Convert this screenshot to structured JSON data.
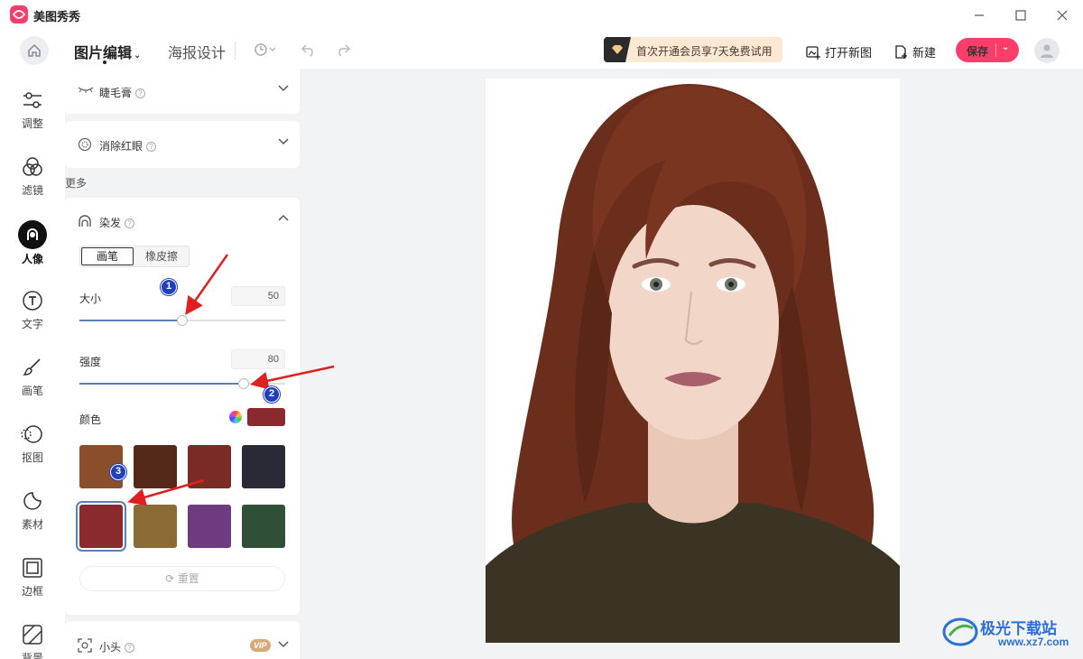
{
  "app": {
    "name": "美图秀秀"
  },
  "toolbar": {
    "tab_edit": "图片编辑",
    "tab_poster": "海报设计",
    "vip_banner": "首次开通会员享7天免费试用",
    "open_image": "打开新图",
    "new": "新建",
    "save": "保存"
  },
  "rail": {
    "items": [
      {
        "label": "调整",
        "icon": "sliders-icon"
      },
      {
        "label": "滤镜",
        "icon": "filter-icon"
      },
      {
        "label": "人像",
        "icon": "portrait-icon"
      },
      {
        "label": "文字",
        "icon": "text-icon"
      },
      {
        "label": "画笔",
        "icon": "brush-icon"
      },
      {
        "label": "抠图",
        "icon": "cutout-icon"
      },
      {
        "label": "素材",
        "icon": "sticker-icon"
      },
      {
        "label": "边框",
        "icon": "frame-icon"
      },
      {
        "label": "背景",
        "icon": "background-icon"
      }
    ]
  },
  "panel": {
    "mascara": {
      "title": "睫毛膏"
    },
    "redeye": {
      "title": "消除红眼"
    },
    "more_label": "更多",
    "dye": {
      "title": "染发",
      "mode_brush": "画笔",
      "mode_eraser": "橡皮擦",
      "size_label": "大小",
      "size_value": "50",
      "size_level": 0.5,
      "strength_label": "强度",
      "strength_value": "80",
      "strength_level": 0.8,
      "color_label": "颜色",
      "current_color": "#8b2a2e",
      "swatches": [
        "#8a4f2a",
        "#55281a",
        "#7a2c24",
        "#2a2a36",
        "#8b2a2e",
        "#8a6b35",
        "#6e3a80",
        "#2f4f36"
      ],
      "selected_swatch": 4,
      "reset": "重置"
    },
    "smallhead": {
      "title": "小头",
      "badge": "VIP"
    }
  },
  "annotations": [
    "1",
    "2",
    "3"
  ],
  "watermark": {
    "text": "极光下载站",
    "url": "www.xz7.com"
  },
  "colors": {
    "accent": "#ff3d6b",
    "slider": "#5b80b8",
    "arrow": "#e02020",
    "badge": "#1f3fbf"
  }
}
